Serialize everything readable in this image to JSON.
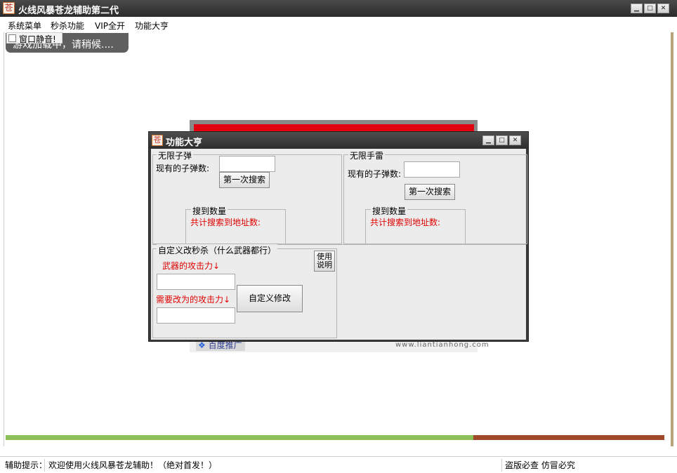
{
  "window": {
    "title": "火线风暴苍龙辅助第二代",
    "icon_char": "苍",
    "minimize": "▁",
    "maximize": "□",
    "close": "✕"
  },
  "menu": [
    "系统菜单",
    "秒杀功能",
    "VIP全开",
    "功能大亨"
  ],
  "mute": {
    "label": "窗口静音!",
    "checked": false
  },
  "loading": {
    "text": "游戏加载中，请稍候...."
  },
  "ad": {
    "baidu_label": "百度推广",
    "url": "www.liantianhong.com",
    "paw_icon": "paw-icon"
  },
  "dialog": {
    "title": "功能大亨",
    "icon_char": "苍",
    "minimize": "▁",
    "maximize": "□",
    "close": "✕",
    "bullets": {
      "legend": "无限子弹",
      "count_label": "现有的子弹数:",
      "count_value": "",
      "search_button": "第一次搜索",
      "found": {
        "legend": "搜到数量",
        "total_label": "共计搜索到地址数:"
      }
    },
    "grenades": {
      "legend": "无限手雷",
      "count_label": "现有的子弹数:",
      "count_value": "",
      "search_button": "第一次搜索",
      "found": {
        "legend": "搜到数量",
        "total_label": "共计搜索到地址数:"
      }
    },
    "custom": {
      "legend": "自定义改秒杀（什么武器都行）",
      "help_button_line1": "使用",
      "help_button_line2": "说明",
      "weapon_attack_label": "武器的攻击力↓",
      "weapon_attack_value": "",
      "target_attack_label": "需要改为的攻击力↓",
      "target_attack_value": "",
      "apply_button": "自定义修改"
    }
  },
  "progress": {
    "fraction": 0.71,
    "fill_color": "#8ec05a",
    "rest_color": "#a0482a"
  },
  "status": {
    "prefix": "辅助提示：",
    "message": "欢迎使用火线风暴苍龙辅助！（绝对首发！）",
    "right": "盗版必查 仿冒必究"
  }
}
